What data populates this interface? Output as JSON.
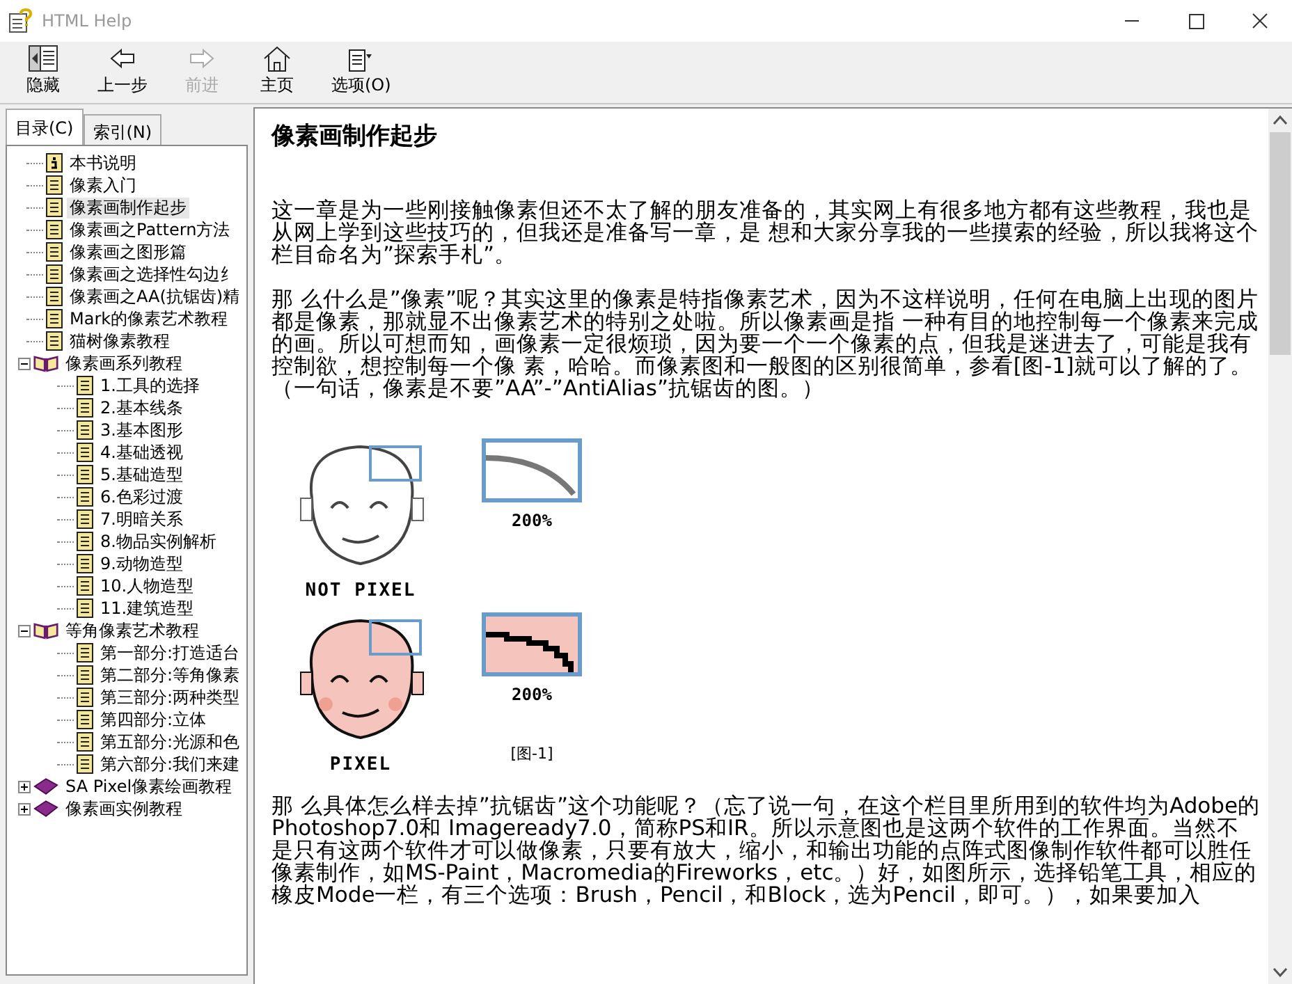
{
  "window": {
    "title": "HTML Help"
  },
  "toolbar": [
    {
      "label": "隐藏",
      "kind": "hide",
      "disabled": false
    },
    {
      "label": "上一步",
      "kind": "back",
      "disabled": false
    },
    {
      "label": "前进",
      "kind": "forward",
      "disabled": true
    },
    {
      "label": "主页",
      "kind": "home",
      "disabled": false
    },
    {
      "label": "选项(O)",
      "kind": "options",
      "disabled": false
    }
  ],
  "tabs": [
    {
      "label": "目录(C)",
      "selected": true
    },
    {
      "label": "索引(N)",
      "selected": false
    }
  ],
  "tree": [
    {
      "label": "本书说明",
      "kind": "info",
      "selected": false
    },
    {
      "label": "像素入门",
      "kind": "page",
      "selected": false
    },
    {
      "label": "像素画制作起步",
      "kind": "page",
      "selected": true
    },
    {
      "label": "像素画之Pattern方法",
      "kind": "page",
      "selected": false
    },
    {
      "label": "像素画之图形篇",
      "kind": "page",
      "selected": false
    },
    {
      "label": "像素画之选择性勾边纟",
      "kind": "page",
      "selected": false
    },
    {
      "label": "像素画之AA(抗锯齿)精",
      "kind": "page",
      "selected": false
    },
    {
      "label": "Mark的像素艺术教程",
      "kind": "page",
      "selected": false
    },
    {
      "label": "猫树像素教程",
      "kind": "page",
      "selected": false
    },
    {
      "label": "像素画系列教程",
      "kind": "book",
      "selected": false,
      "expanded": true,
      "children": [
        {
          "label": "1.工具的选择",
          "kind": "page",
          "selected": false
        },
        {
          "label": "2.基本线条",
          "kind": "page",
          "selected": false
        },
        {
          "label": "3.基本图形",
          "kind": "page",
          "selected": false
        },
        {
          "label": "4.基础透视",
          "kind": "page",
          "selected": false
        },
        {
          "label": "5.基础造型",
          "kind": "page",
          "selected": false
        },
        {
          "label": "6.色彩过渡",
          "kind": "page",
          "selected": false
        },
        {
          "label": "7.明暗关系",
          "kind": "page",
          "selected": false
        },
        {
          "label": "8.物品实例解析",
          "kind": "page",
          "selected": false
        },
        {
          "label": "9.动物造型",
          "kind": "page",
          "selected": false
        },
        {
          "label": "10.人物造型",
          "kind": "page",
          "selected": false
        },
        {
          "label": "11.建筑造型",
          "kind": "page",
          "selected": false
        }
      ]
    },
    {
      "label": "等角像素艺术教程",
      "kind": "book",
      "selected": false,
      "expanded": true,
      "children": [
        {
          "label": "第一部分:打造适台",
          "kind": "page",
          "selected": false
        },
        {
          "label": "第二部分:等角像素",
          "kind": "page",
          "selected": false
        },
        {
          "label": "第三部分:两种类型",
          "kind": "page",
          "selected": false
        },
        {
          "label": "第四部分:立体",
          "kind": "page",
          "selected": false
        },
        {
          "label": "第五部分:光源和色",
          "kind": "page",
          "selected": false
        },
        {
          "label": "第六部分:我们来建",
          "kind": "page",
          "selected": false
        }
      ]
    },
    {
      "label": "SA Pixel像素绘画教程",
      "kind": "book",
      "selected": false,
      "expanded": false
    },
    {
      "label": "像素画实例教程",
      "kind": "book",
      "selected": false,
      "expanded": false
    }
  ],
  "article": {
    "title": "像素画制作起步",
    "paragraphs": [
      "这一章是为一些刚接触像素但还不太了解的朋友准备的，其实网上有很多地方都有这些教程，我也是从网上学到这些技巧的，但我还是准备写一章，是 想和大家分享我的一些摸索的经验，所以我将这个栏目命名为”探索手札”。",
      "那 么什么是”像素”呢？其实这里的像素是特指像素艺术，因为不这样说明，任何在电脑上出现的图片都是像素，那就显不出像素艺术的特别之处啦。所以像素画是指 一种有目的地控制每一个像素来完成的画。所以可想而知，画像素一定很烦琐，因为要一个一个像素的点，但我是迷进去了，可能是我有控制欲，想控制每一个像 素，哈哈。而像素图和一般图的区别很简单，参看[图-1]就可以了解的了。（一句话，像素是不要”AA”-”AntiAlias”抗锯齿的图。）"
    ],
    "figure": {
      "rows": [
        {
          "kind": "smooth",
          "label": "NOT PIXEL",
          "zoom_label": "200%"
        },
        {
          "kind": "pixel",
          "label": "PIXEL",
          "zoom_label": "200%"
        }
      ],
      "caption": "[图-1]"
    },
    "paragraphs_after": [
      "那 么具体怎么样去掉”抗锯齿”这个功能呢？（忘了说一句，在这个栏目里所用到的软件均为Adobe的Photoshop7.0和 Imageready7.0，简称PS和IR。所以示意图也是这两个软件的工作界面。当然不是只有这两个软件才可以做像素，只要有放大，缩小，和输出功能的点阵式图像制作软件都可以胜任像素制作，如MS-Paint，Macromedia的Fireworks，etc。）好，如图所示，选择铅笔工具，相应的橡皮Mode一栏，有三个选项：Brush，Pencil，和Block，选为Pencil，即可。），如果要加入"
    ]
  }
}
